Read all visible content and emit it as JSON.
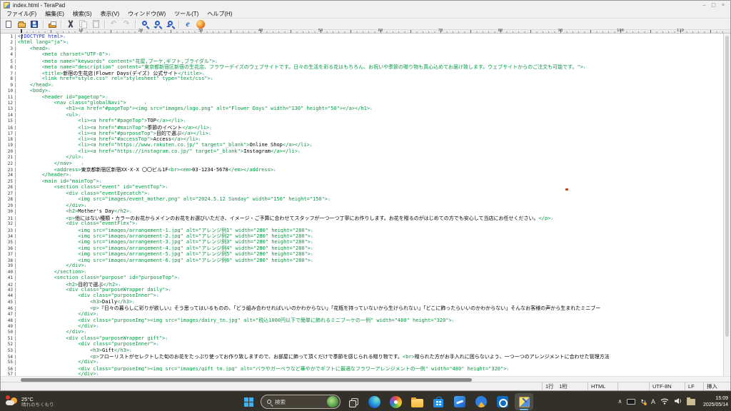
{
  "window": {
    "title": "index.html - TeraPad",
    "controls": [
      "minimize",
      "maximize",
      "close"
    ]
  },
  "menu_bar": {
    "items": [
      "ファイル(F)",
      "編集(E)",
      "検索(S)",
      "表示(V)",
      "ウィンドウ(W)",
      "ツール(T)",
      "ヘルプ(H)"
    ]
  },
  "toolbar": {
    "buttons": [
      {
        "name": "new-file-icon",
        "cls": "i-new"
      },
      {
        "name": "open-file-icon",
        "cls": "i-open"
      },
      {
        "name": "save-icon",
        "cls": "i-save"
      },
      {
        "sep": true
      },
      {
        "name": "print-icon",
        "cls": "i-print"
      },
      {
        "sep": true
      },
      {
        "name": "cut-icon",
        "cls": "i-cut"
      },
      {
        "name": "copy-icon",
        "cls": "i-copy",
        "disabled": true
      },
      {
        "name": "paste-icon",
        "cls": "i-paste",
        "disabled": true
      },
      {
        "sep": true
      },
      {
        "name": "undo-icon",
        "cls": "i-undo",
        "glyph": "↶",
        "disabled": true
      },
      {
        "name": "redo-icon",
        "cls": "i-redo",
        "glyph": "↷",
        "disabled": true
      },
      {
        "sep": true
      },
      {
        "name": "search-icon",
        "cls": "i-find"
      },
      {
        "name": "search-next-icon",
        "cls": "i-findnext"
      },
      {
        "name": "search-prev-icon",
        "cls": "i-findprev"
      },
      {
        "sep": true
      },
      {
        "name": "ie-browser-icon",
        "cls": "i-ie",
        "glyph": "e"
      },
      {
        "name": "firefox-browser-icon",
        "cls": "i-moz"
      }
    ]
  },
  "ruler": {
    "unit_labels": [
      10,
      20,
      30,
      40,
      50,
      60,
      70,
      80,
      90,
      100,
      110
    ]
  },
  "editor": {
    "newline_mark": "↓",
    "caret": {
      "line": 1,
      "col": 1
    },
    "lines": [
      {
        "n": 1,
        "s": [
          [
            "d",
            "<!DOCTYPE html>"
          ]
        ]
      },
      {
        "n": 2,
        "s": [
          [
            "t",
            "<html lang=\"ja\">"
          ]
        ]
      },
      {
        "n": 3,
        "s": [
          [
            "t",
            "    <head>"
          ]
        ]
      },
      {
        "n": 4,
        "s": [
          [
            "t",
            "        <meta charset=\"UTF-8\">"
          ]
        ]
      },
      {
        "n": 5,
        "s": [
          [
            "t",
            "        <meta name=\"keywords\" content=\"花屋,ブーケ,ギフト,ブライダル\">"
          ]
        ]
      },
      {
        "n": 6,
        "s": [
          [
            "t",
            "        <meta name=\"description\" content=\"東京都新宿区新宿の生花店、フラワーデイズのウェブサイトです。日々の生活を彩る花はもちろん、お祝いや季節の贈り物も真心込めてお届け致します。ウェブサイトからのご注文も可能です。\">"
          ]
        ]
      },
      {
        "n": 7,
        "s": [
          [
            "t",
            "        <title>"
          ],
          [
            "x",
            "新宿の生花店|Flower Days(デイズ) 公式サイト"
          ],
          [
            "t",
            "</title>"
          ]
        ]
      },
      {
        "n": 8,
        "s": [
          [
            "t",
            "        <link href=\"style.css\" rel=\"stylesheet\" type=\"text/css\">"
          ]
        ]
      },
      {
        "n": 9,
        "s": [
          [
            "t",
            "    </head>"
          ]
        ]
      },
      {
        "n": 10,
        "s": [
          [
            "t",
            "    <body>"
          ]
        ]
      },
      {
        "n": 11,
        "s": [
          [
            "t",
            "        <header id=\"pagetop\">"
          ]
        ]
      },
      {
        "n": 12,
        "s": [
          [
            "t",
            "            <nav class=\"globalNavi\">"
          ],
          [
            "x",
            "      "
          ]
        ]
      },
      {
        "n": 13,
        "s": [
          [
            "t",
            "                <h1><a href=\"#pageTop\"><img src=\"images/logo.png\" alt=\"Flower Days\" width=\"130\" height=\"50\"></a></h1>"
          ]
        ]
      },
      {
        "n": 14,
        "s": [
          [
            "t",
            "                <ul>"
          ]
        ]
      },
      {
        "n": 15,
        "s": [
          [
            "t",
            "                    <li><a href=\"#pageTop\">"
          ],
          [
            "x",
            "TOP"
          ],
          [
            "t",
            "</a></li>"
          ]
        ]
      },
      {
        "n": 16,
        "s": [
          [
            "t",
            "                    <li><a href=\"#mainTop\">"
          ],
          [
            "x",
            "季節のイベント"
          ],
          [
            "t",
            "</a></li>"
          ]
        ]
      },
      {
        "n": 17,
        "s": [
          [
            "t",
            "                    <li><a href=\"#purposeTop\">"
          ],
          [
            "x",
            "目的で選ぶ"
          ],
          [
            "t",
            "</a></li>"
          ]
        ]
      },
      {
        "n": 18,
        "s": [
          [
            "t",
            "                    <li><a href=\"#accessTop\">"
          ],
          [
            "x",
            "Access"
          ],
          [
            "t",
            "</a></li>"
          ]
        ]
      },
      {
        "n": 19,
        "s": [
          [
            "t",
            "                    <li><a href=\"https://www.rakuten.co.jp/\" target=\"_blank\">"
          ],
          [
            "x",
            "Online Shop"
          ],
          [
            "t",
            "</a></li>"
          ]
        ]
      },
      {
        "n": 20,
        "s": [
          [
            "t",
            "                    <li><a href=\"https://instagram.co.jp/\" target=\"_blank\">"
          ],
          [
            "x",
            "Instagram"
          ],
          [
            "t",
            "</a></li>"
          ]
        ]
      },
      {
        "n": 21,
        "s": [
          [
            "t",
            "                </ul>"
          ]
        ]
      },
      {
        "n": 22,
        "s": [
          [
            "t",
            "            </nav>"
          ],
          [
            "x",
            "   "
          ]
        ]
      },
      {
        "n": 23,
        "s": [
          [
            "t",
            "            <address>"
          ],
          [
            "x",
            "東京都新宿区新宿XX-X-X 〇〇ビル1F"
          ],
          [
            "t",
            "<br><em>"
          ],
          [
            "x",
            "03-1234-5678"
          ],
          [
            "t",
            "</em></address>"
          ]
        ]
      },
      {
        "n": 24,
        "s": [
          [
            "t",
            "        </header>"
          ]
        ]
      },
      {
        "n": 25,
        "s": [
          [
            "t",
            "        <main id=\"mainTop\">"
          ]
        ]
      },
      {
        "n": 26,
        "s": [
          [
            "t",
            "            <section class=\"event\" id=\"eventTop\">"
          ]
        ]
      },
      {
        "n": 27,
        "s": [
          [
            "t",
            "                <div class=\"eventEyecatch\">"
          ]
        ]
      },
      {
        "n": 28,
        "s": [
          [
            "t",
            "                    <img src=\"images/event_mother.png\" alt=\"2024.5.12 Sunday\" width=\"150\" height=\"150\">"
          ]
        ]
      },
      {
        "n": 29,
        "s": [
          [
            "t",
            "                </div>"
          ]
        ]
      },
      {
        "n": 30,
        "s": [
          [
            "t",
            "                <h2>"
          ],
          [
            "x",
            "Mother's Day"
          ],
          [
            "t",
            "</h2>"
          ]
        ]
      },
      {
        "n": 31,
        "s": [
          [
            "t",
            "                <p>"
          ],
          [
            "x",
            "他にはない種類・カラーのお花からメインのお花をお選びいただき、イメージ・ご予算に合わせてスタッフが一つ一つ丁寧にお作りします。お花を贈るのがはじめての方でも安心して当店にお任せください。"
          ],
          [
            "t",
            "</p>"
          ]
        ]
      },
      {
        "n": 32,
        "s": [
          [
            "t",
            "                <div class=\"eventFlex\">"
          ]
        ]
      },
      {
        "n": 33,
        "s": [
          [
            "t",
            "                    <img src=\"images/arrangement-1.jpg\" alt=\"アレンジ例1\" width=\"280\" height=\"280\">"
          ]
        ]
      },
      {
        "n": 34,
        "s": [
          [
            "t",
            "                    <img src=\"images/arrangement-2.jpg\" alt=\"アレンジ例2\" width=\"280\" height=\"280\">"
          ]
        ]
      },
      {
        "n": 35,
        "s": [
          [
            "t",
            "                    <img src=\"images/arrangement-3.jpg\" alt=\"アレンジ例3\" width=\"280\" height=\"280\">"
          ]
        ]
      },
      {
        "n": 36,
        "s": [
          [
            "t",
            "                    <img src=\"images/arrangement-4.jpg\" alt=\"アレンジ例4\" width=\"280\" height=\"280\">"
          ]
        ]
      },
      {
        "n": 37,
        "s": [
          [
            "t",
            "                    <img src=\"images/arrangement-5.jpg\" alt=\"アレンジ例5\" width=\"280\" height=\"280\">"
          ]
        ]
      },
      {
        "n": 38,
        "s": [
          [
            "t",
            "                    <img src=\"images/arrangement-6.jpg\" alt=\"アレンジ例6\" width=\"280\" height=\"280\">"
          ]
        ]
      },
      {
        "n": 39,
        "s": [
          [
            "t",
            "                </div>"
          ]
        ]
      },
      {
        "n": 40,
        "s": [
          [
            "t",
            "            </section>"
          ]
        ]
      },
      {
        "n": 41,
        "s": [
          [
            "t",
            "            <section class=\"purpose\" id=\"purposeTop\">"
          ]
        ]
      },
      {
        "n": 42,
        "s": [
          [
            "t",
            "                <h2>"
          ],
          [
            "x",
            "目的で選ぶ"
          ],
          [
            "t",
            "</h2>"
          ]
        ]
      },
      {
        "n": 43,
        "s": [
          [
            "t",
            "                <div class=\"purposeWrapper daily\">"
          ]
        ]
      },
      {
        "n": 44,
        "s": [
          [
            "t",
            "                    <div class=\"purposeInner\">"
          ]
        ]
      },
      {
        "n": 45,
        "s": [
          [
            "t",
            "                        <h3>"
          ],
          [
            "x",
            "Daily"
          ],
          [
            "t",
            "</h3>"
          ]
        ]
      },
      {
        "n": 46,
        "c": 1,
        "s": [
          [
            "t",
            "                        <p>"
          ],
          [
            "x",
            "『日々の暮らしに彩りが欲しい』そう思ってはいるものの、「どう組み合わせればいいのかわからない」「花瓶を持っていないから生けられない」「どこに飾ったらいいのかわからない」そんなお客様の声から生まれたミニブー"
          ]
        ]
      },
      {
        "n": 47,
        "s": [
          [
            "t",
            "                    </div>"
          ]
        ]
      },
      {
        "n": 48,
        "s": [
          [
            "t",
            "                    <div class=\"purposeImg\"><img src=\"images/dairy_tn.jpg\" alt=\"税込1000円以下で簡単に飾れるミニブーケの一例\" width=\"480\" height=\"320\">"
          ]
        ]
      },
      {
        "n": 49,
        "s": [
          [
            "t",
            "                    </div>"
          ]
        ]
      },
      {
        "n": 50,
        "s": [
          [
            "t",
            "                </div>"
          ]
        ]
      },
      {
        "n": 51,
        "s": [
          [
            "t",
            "                <div class=\"purposeWrapper gift\">"
          ]
        ]
      },
      {
        "n": 52,
        "s": [
          [
            "t",
            "                    <div class=\"purposeInner\">"
          ]
        ]
      },
      {
        "n": 53,
        "s": [
          [
            "t",
            "                        <h3>"
          ],
          [
            "x",
            "Gift"
          ],
          [
            "t",
            "</h3>"
          ]
        ]
      },
      {
        "n": 54,
        "c": 1,
        "s": [
          [
            "t",
            "                        <p>"
          ],
          [
            "x",
            "フローリストがセレクトした旬のお花をたっぷり使ってお作り致しますので、お部屋に飾って頂くだけで季節を感じられる贈り物です。"
          ],
          [
            "t",
            "<br>"
          ],
          [
            "x",
            "贈られた方がお手入れに困らないよう、一つ一つのアレンジメントに合わせた管理方法"
          ]
        ]
      },
      {
        "n": 55,
        "s": [
          [
            "t",
            "                    </div>"
          ]
        ]
      },
      {
        "n": 56,
        "s": [
          [
            "t",
            "                    <div class=\"purposeImg\"><img src=\"images/gift_tn.jpg\" alt=\"バラやガーベラなど華やかでギフトに最適なフラワーアレンジメントの一例\" width=\"480\" height=\"320\">"
          ]
        ]
      },
      {
        "n": 57,
        "s": [
          [
            "t",
            "                    </div>"
          ]
        ]
      }
    ]
  },
  "status_bar": {
    "cells": [
      "1行　1桁",
      "HTML",
      "",
      "UTF-8N",
      "LF",
      "挿入"
    ]
  },
  "taskbar": {
    "weather": {
      "temp": "25°C",
      "condition": "晴れのちくもり"
    },
    "search": {
      "placeholder": "検索"
    },
    "apps": [
      {
        "name": "start-button-icon",
        "cls": "i-start"
      },
      {
        "name": "search-pill",
        "pill": true
      },
      {
        "name": "task-view-icon",
        "cls": "i-taskview"
      },
      {
        "name": "edge-icon",
        "cls": "i-edge"
      },
      {
        "name": "photos-icon",
        "cls": "i-photos"
      },
      {
        "name": "file-explorer-icon",
        "cls": "i-folder"
      },
      {
        "name": "store-icon",
        "cls": "i-store"
      },
      {
        "name": "mail-app-icon",
        "cls": "i-bluebox"
      },
      {
        "name": "help-app-icon",
        "cls": "i-help"
      },
      {
        "name": "outlook-icon",
        "cls": "i-outlook"
      },
      {
        "name": "terapad-icon",
        "cls": "i-terapad",
        "active": true
      }
    ],
    "tray": {
      "chevron": "∧",
      "sync": "↻",
      "ime": "A",
      "time": "15:09",
      "date": "2025/05/14"
    }
  }
}
